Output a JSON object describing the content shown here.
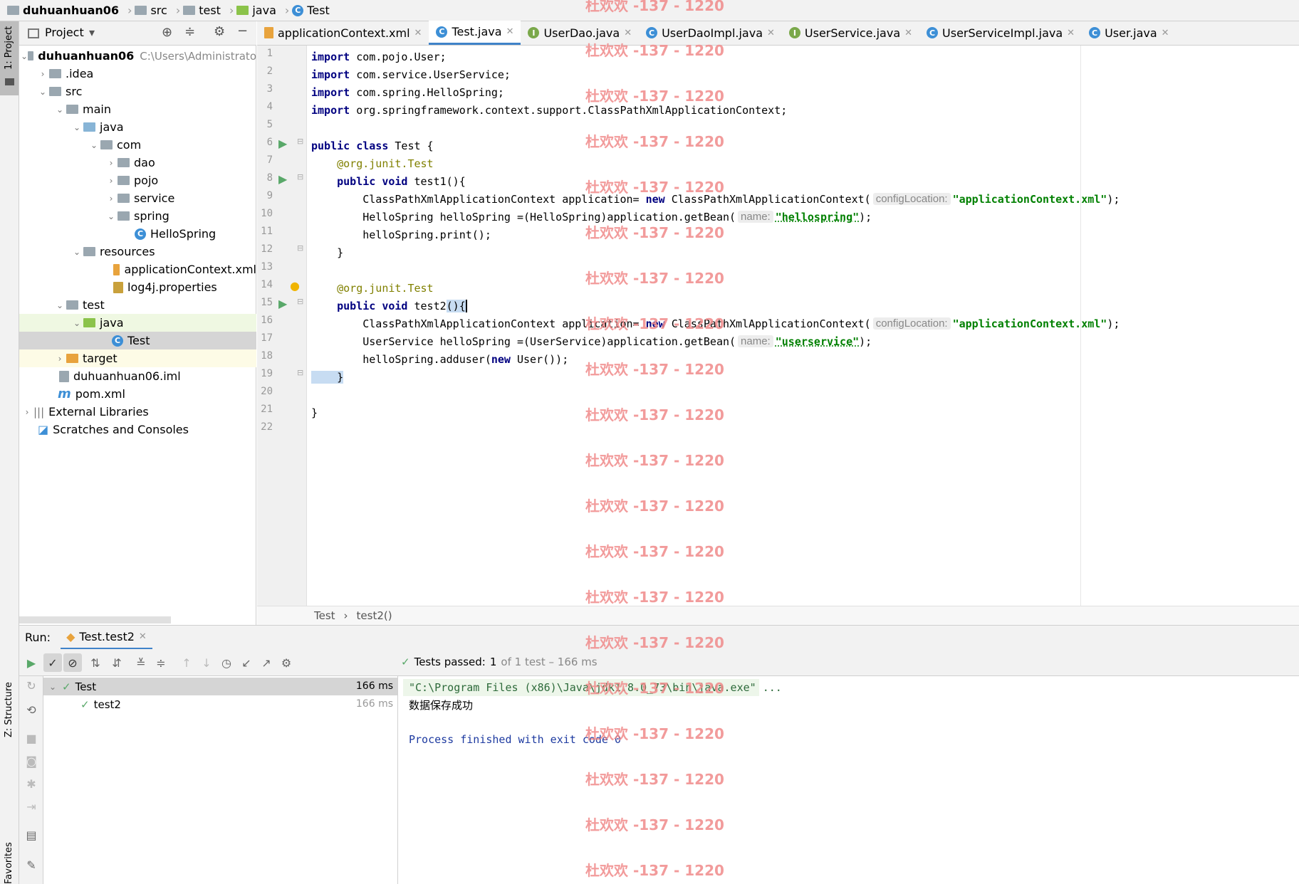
{
  "breadcrumb": {
    "project": "duhuanhuan06",
    "items": [
      "src",
      "test",
      "java",
      "Test"
    ]
  },
  "left_tool": {
    "project_tab": "1: Project",
    "structure_tab": "Z: Structure",
    "favorites_tab": "Favorites"
  },
  "project_panel": {
    "title": "Project",
    "root_name": "duhuanhuan06",
    "root_path": "C:\\Users\\Administrato",
    "items": [
      {
        "label": ".idea"
      },
      {
        "label": "src"
      },
      {
        "label": "main"
      },
      {
        "label": "java"
      },
      {
        "label": "com"
      },
      {
        "label": "dao"
      },
      {
        "label": "pojo"
      },
      {
        "label": "service"
      },
      {
        "label": "spring"
      },
      {
        "label": "HelloSpring"
      },
      {
        "label": "resources"
      },
      {
        "label": "applicationContext.xml"
      },
      {
        "label": "log4j.properties"
      },
      {
        "label": "test"
      },
      {
        "label": "java"
      },
      {
        "label": "Test"
      },
      {
        "label": "target"
      },
      {
        "label": "duhuanhuan06.iml"
      },
      {
        "label": "pom.xml"
      },
      {
        "label": "External Libraries"
      },
      {
        "label": "Scratches and Consoles"
      }
    ]
  },
  "editor_tabs": [
    {
      "label": "applicationContext.xml"
    },
    {
      "label": "Test.java"
    },
    {
      "label": "UserDao.java"
    },
    {
      "label": "UserDaoImpl.java"
    },
    {
      "label": "UserService.java"
    },
    {
      "label": "UserServiceImpl.java"
    },
    {
      "label": "User.java"
    }
  ],
  "code_lines": [
    {
      "n": "1",
      "a": "import",
      "b": " com.pojo.User;"
    },
    {
      "n": "2",
      "a": "import",
      "b": " com.service.UserService;"
    },
    {
      "n": "3",
      "a": "import",
      "b": " com.spring.HelloSpring;"
    },
    {
      "n": "4",
      "a": "import",
      "b": " org.springframework.context.support.ClassPathXmlApplicationContext;"
    },
    {
      "n": "5"
    },
    {
      "n": "6"
    },
    {
      "n": "7"
    },
    {
      "n": "8"
    },
    {
      "n": "9"
    },
    {
      "n": "10"
    },
    {
      "n": "11"
    },
    {
      "n": "12"
    },
    {
      "n": "13"
    },
    {
      "n": "14"
    },
    {
      "n": "15"
    },
    {
      "n": "16"
    },
    {
      "n": "17"
    },
    {
      "n": "18"
    },
    {
      "n": "19"
    },
    {
      "n": "20"
    },
    {
      "n": "21"
    },
    {
      "n": "22"
    }
  ],
  "code": {
    "l6a": "public class",
    "l6b": " Test {",
    "l7a": "    @org.junit.",
    "l7b": "Test",
    "l8a": "    public void",
    "l8b": " test1(){",
    "l9a": "        ClassPathXmlApplicationContext application= ",
    "l9k": "new",
    "l9b": " ClassPathXmlApplicationContext(",
    "l9h": "configLocation:",
    "l9s": "\"applicationContext.xml\"",
    "l9e": ");",
    "l10a": "        HelloSpring helloSpring =(HelloSpring)application.getBean(",
    "l10h": "name:",
    "l10s": "\"hellospring\"",
    "l10e": ");",
    "l11": "        helloSpring.print();",
    "l12": "    }",
    "l14a": "    @org.junit.",
    "l14b": "Test",
    "l15a": "    public void",
    "l15b": " test2",
    "l15c": "(){",
    "l16a": "        ClassPathXmlApplicationContext application= ",
    "l16k": "new",
    "l16b": " ClassPathXmlApplicationContext(",
    "l16h": "configLocation:",
    "l16s": "\"applicationContext.xml\"",
    "l16e": ");",
    "l17a": "        UserService helloSpring =(UserService)application.getBean(",
    "l17h": "name:",
    "l17s": "\"userservice\"",
    "l17e": ");",
    "l18a": "        helloSpring.adduser(",
    "l18k": "new",
    "l18b": " User());",
    "l19": "    }",
    "l21": "}"
  },
  "editor_breadcrumb": {
    "class": "Test",
    "method": "test2()"
  },
  "run": {
    "label": "Run:",
    "tab": "Test.test2",
    "status_prefix": "Tests passed:",
    "passed": "1",
    "status_suffix": "of 1 test – 166 ms",
    "tree": [
      {
        "label": "Test",
        "time": "166 ms"
      },
      {
        "label": "test2",
        "time": "166 ms"
      }
    ],
    "console": [
      "\"C:\\Program Files (x86)\\Java\\jdk1.8.0_73\\bin\\java.exe\" ...",
      "数据保存成功",
      "",
      "Process finished with exit code 0"
    ]
  },
  "watermark": "杜欢欢 -137 - 1220",
  "colors": {
    "keyword": "#000080",
    "annotation": "#808000",
    "string": "#008000",
    "watermark": "#f08a8a",
    "accent": "#4083c9",
    "pass": "#59a869"
  }
}
